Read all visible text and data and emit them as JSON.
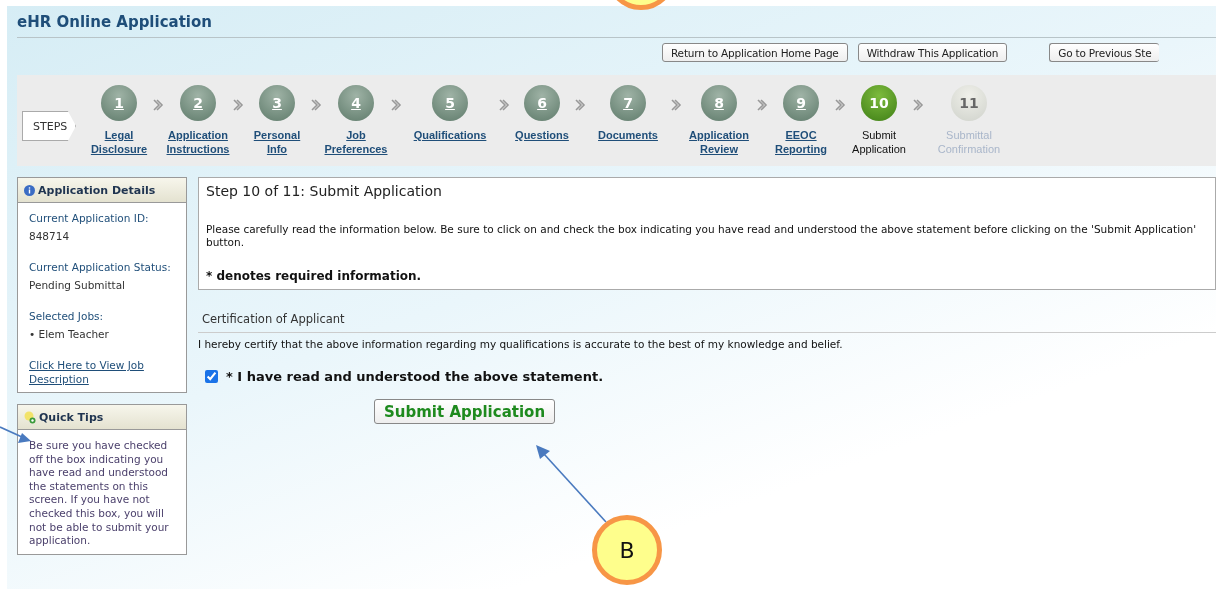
{
  "header": {
    "title": "eHR Online Application"
  },
  "actions": [
    {
      "label": "Return to Application Home Page"
    },
    {
      "label": "Withdraw This Application"
    },
    {
      "label": "Go to Previous Ste"
    }
  ],
  "steps": {
    "tag": "STEPS",
    "items": [
      {
        "number": "1",
        "label": "Legal Disclosure",
        "selected": false,
        "disabled": false
      },
      {
        "number": "2",
        "label": "Application Instructions",
        "selected": false,
        "disabled": false
      },
      {
        "number": "3",
        "label": "Personal Info",
        "selected": false,
        "disabled": false
      },
      {
        "number": "4",
        "label": "Job Preferences",
        "selected": false,
        "disabled": false
      },
      {
        "number": "5",
        "label": "Qualifications",
        "selected": false,
        "disabled": false
      },
      {
        "number": "6",
        "label": "Questions",
        "selected": false,
        "disabled": false
      },
      {
        "number": "7",
        "label": "Documents",
        "selected": false,
        "disabled": false
      },
      {
        "number": "8",
        "label": "Application Review",
        "selected": false,
        "disabled": false
      },
      {
        "number": "9",
        "label": "EEOC Reporting",
        "selected": false,
        "disabled": false
      },
      {
        "number": "10",
        "label": "Submit Application",
        "selected": true,
        "disabled": false
      },
      {
        "number": "11",
        "label": "Submittal Confirmation",
        "selected": false,
        "disabled": true
      }
    ]
  },
  "details": {
    "title": "Application Details",
    "fields": [
      {
        "label": "Current Application ID:",
        "value": "848714"
      },
      {
        "label": "Current Application Status:",
        "value": "Pending Submittal"
      },
      {
        "label": "Selected Jobs:",
        "value": "• Elem Teacher"
      }
    ],
    "link": "Click Here to View Job Description"
  },
  "tips": {
    "title": "Quick Tips",
    "text": "Be sure you have checked off the box indicating you have read and understood the statements on this screen. If you have not checked this box, you will not be able to submit your application."
  },
  "main": {
    "heading": "Step 10 of 11: Submit Application",
    "intro": "Please carefully read the information below. Be sure to click on and check the box indicating you have read and understood the above statement before clicking on the 'Submit Application' button.",
    "required_note": "* denotes required information.",
    "section_title": "Certification of Applicant",
    "certification": "I hereby certify that the above information regarding my qualifications is accurate to the best of my knowledge and belief.",
    "agreement": {
      "label": "* I have read and understood the above statement.",
      "checked": true
    },
    "submit": "Submit Application"
  },
  "callout": {
    "label": "B"
  }
}
